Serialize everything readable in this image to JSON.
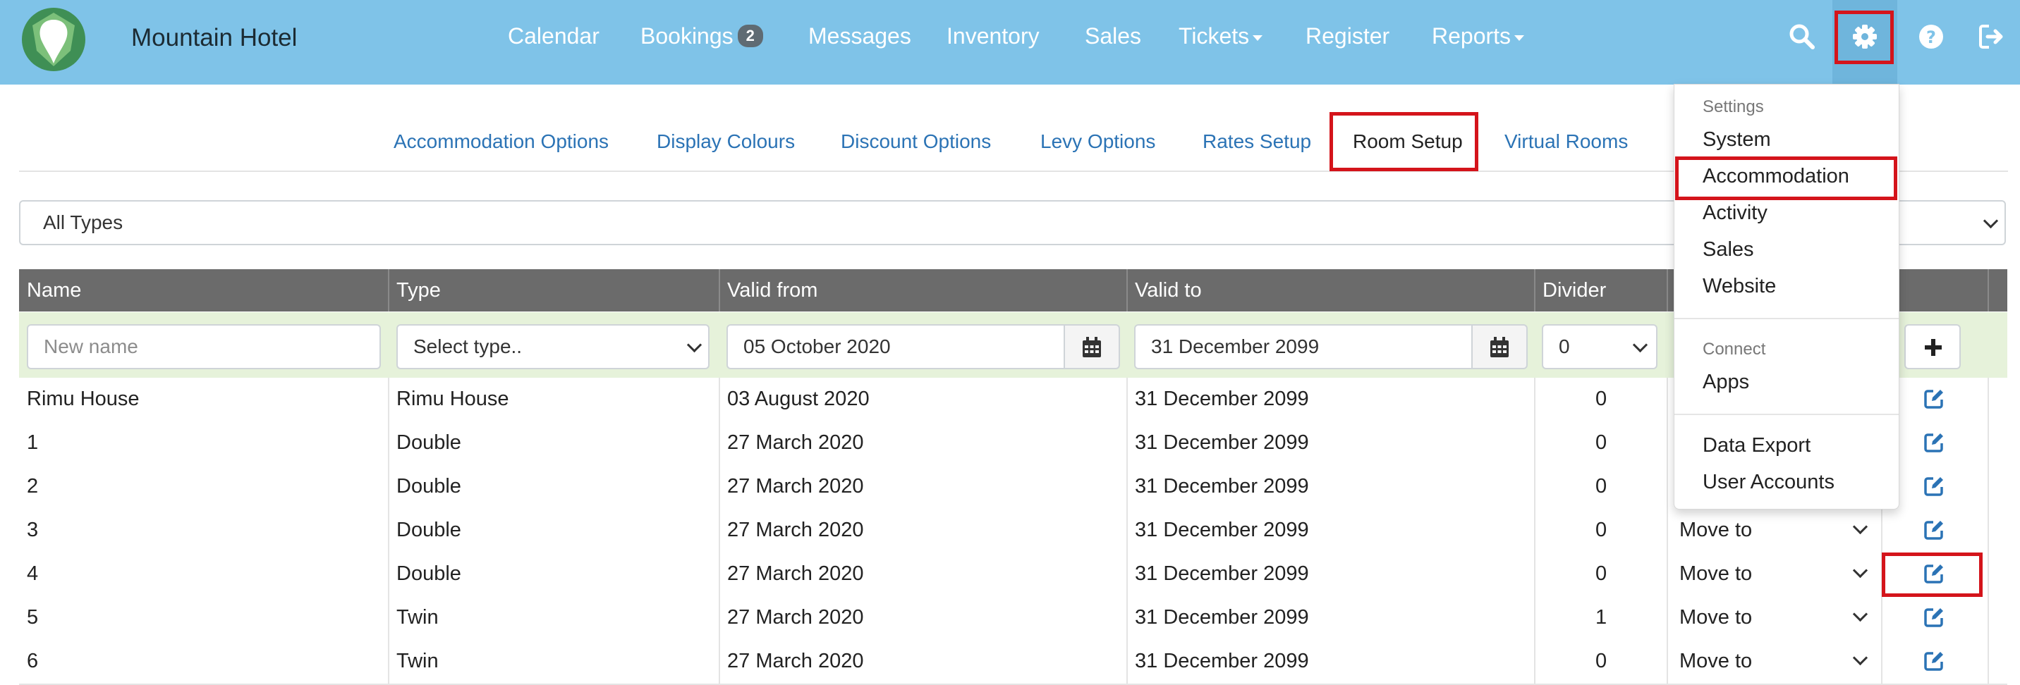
{
  "header": {
    "brand": "Mountain Hotel",
    "nav": [
      {
        "label": "Calendar"
      },
      {
        "label": "Bookings",
        "badge": "2"
      },
      {
        "label": "Messages"
      },
      {
        "label": "Inventory"
      },
      {
        "label": "Sales"
      },
      {
        "label": "Tickets"
      },
      {
        "label": "Register"
      },
      {
        "label": "Reports"
      }
    ],
    "icons": [
      "search-icon",
      "gear-icon",
      "help-icon",
      "logout-icon"
    ]
  },
  "subtabs": [
    {
      "label": "Accommodation Options"
    },
    {
      "label": "Display Colours"
    },
    {
      "label": "Discount Options"
    },
    {
      "label": "Levy Options"
    },
    {
      "label": "Rates Setup"
    },
    {
      "label": "Room Setup",
      "active": true
    },
    {
      "label": "Virtual Rooms"
    }
  ],
  "filter": {
    "selected": "All Types"
  },
  "table": {
    "columns": [
      "Name",
      "Type",
      "Valid from",
      "Valid to",
      "Divider"
    ],
    "new_row": {
      "name_placeholder": "New name",
      "type_value": "Select type..",
      "valid_from": "05 October 2020",
      "valid_to": "31 December 2099",
      "divider": "0"
    },
    "rows": [
      {
        "name": "Rimu House",
        "type": "Rimu House",
        "from": "03 August 2020",
        "to": "31 December 2099",
        "divider": "0",
        "move": ""
      },
      {
        "name": "1",
        "type": "Double",
        "from": "27 March 2020",
        "to": "31 December 2099",
        "divider": "0",
        "move": ""
      },
      {
        "name": "2",
        "type": "Double",
        "from": "27 March 2020",
        "to": "31 December 2099",
        "divider": "0",
        "move": ""
      },
      {
        "name": "3",
        "type": "Double",
        "from": "27 March 2020",
        "to": "31 December 2099",
        "divider": "0",
        "move": "Move to"
      },
      {
        "name": "4",
        "type": "Double",
        "from": "27 March 2020",
        "to": "31 December 2099",
        "divider": "0",
        "move": "Move to"
      },
      {
        "name": "5",
        "type": "Twin",
        "from": "27 March 2020",
        "to": "31 December 2099",
        "divider": "1",
        "move": "Move to"
      },
      {
        "name": "6",
        "type": "Twin",
        "from": "27 March 2020",
        "to": "31 December 2099",
        "divider": "0",
        "move": "Move to"
      }
    ]
  },
  "settings_menu": {
    "header_settings": "Settings",
    "items_settings": [
      "System",
      "Accommodation",
      "Activity",
      "Sales",
      "Website"
    ],
    "header_connect": "Connect",
    "items_connect": [
      "Apps"
    ],
    "items_other": [
      "Data Export",
      "User Accounts"
    ]
  },
  "colors": {
    "navbar": "#7fc3e8",
    "link": "#2b73b5",
    "table_header": "#6b6b6b",
    "new_row": "#e6f2da",
    "highlight": "#d4141b"
  }
}
